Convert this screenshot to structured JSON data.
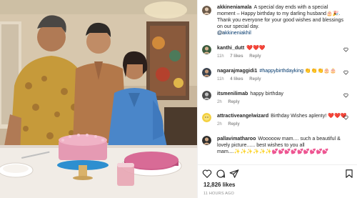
{
  "post": {
    "likes_label": "12,826 likes",
    "posted_ago": "11 HOURS AGO"
  },
  "caption": {
    "username": "akkineniamala",
    "text": "A special day ends with a special moment – Happy birthday to my darling husband🎂🎉. Thank you everyone for your good wishes and blessings on our special day.",
    "mention": "@akkineniakhil",
    "time": "11h"
  },
  "comments": [
    {
      "username": "kanthi_dutt",
      "text": "❤️❤️❤️",
      "time": "11h",
      "likes": "7 likes",
      "reply": "Reply"
    },
    {
      "username": "nagarajmaggidi1",
      "text": "#happybirthdayking 👏👏👏🎂🎂",
      "time": "11h",
      "likes": "4 likes",
      "reply": "Reply"
    },
    {
      "username": "itsmenilimab",
      "text": "happy birthday",
      "time": "2h",
      "likes": "",
      "reply": "Reply"
    },
    {
      "username": "attractiveangelwizard",
      "text": "Birthday Wishes aplenty! ❤️❤️❤️",
      "time": "2h",
      "likes": "",
      "reply": "Reply"
    },
    {
      "username": "pallavimatharoo",
      "text": "Wooooow mam.... such a beautiful & lovely picture...... best wishes to you all mam....✨✨✨✨✨✨💕💕💕💕💕💕💕💕💕",
      "time": "",
      "likes": "",
      "reply": ""
    }
  ],
  "icons": {
    "like": "heart-icon",
    "comment": "comment-icon",
    "share": "share-icon",
    "save": "bookmark-icon"
  },
  "colors": {
    "link": "#00376b",
    "muted": "#8e8e8e",
    "heart": "#ed1c24"
  }
}
